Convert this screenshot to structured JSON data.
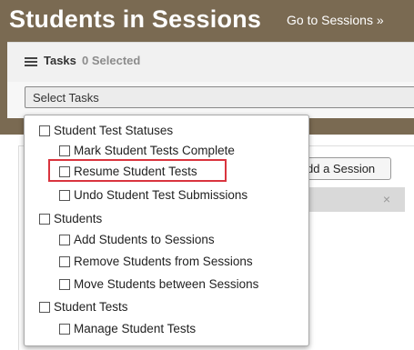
{
  "header": {
    "title": "Students in Sessions",
    "goto_link": "Go to Sessions »",
    "tasks_label": "Tasks",
    "selected_count": "0 Selected",
    "select_placeholder": "Select Tasks"
  },
  "dropdown": {
    "groups": [
      {
        "label": "Student Test Statuses",
        "items": [
          "Mark Student Tests Complete",
          "Resume Student Tests",
          "Undo Student Test Submissions"
        ]
      },
      {
        "label": "Students",
        "items": [
          "Add Students to Sessions",
          "Remove Students from Sessions",
          "Move Students between Sessions"
        ]
      },
      {
        "label": "Student Tests",
        "items": [
          "Manage Student Tests"
        ]
      }
    ]
  },
  "background": {
    "add_session_button": "dd a Session",
    "close_glyph": "×"
  },
  "colors": {
    "header_bg": "#7a6a52",
    "highlight": "#d9343e"
  }
}
